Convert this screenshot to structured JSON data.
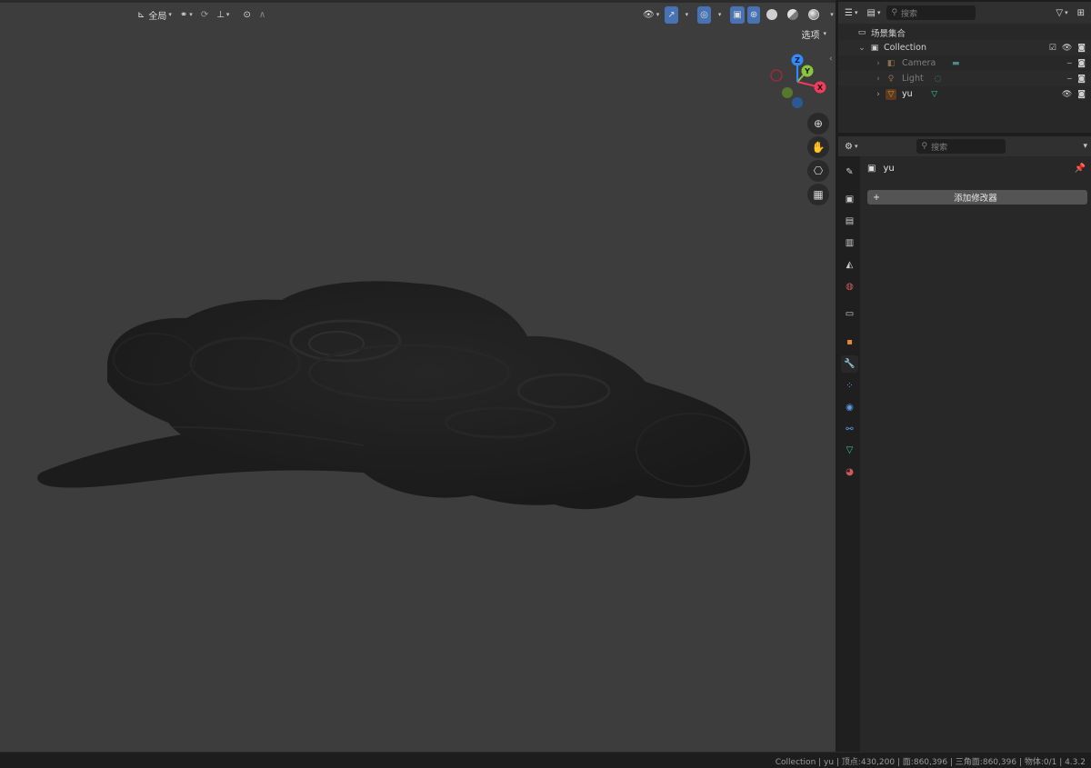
{
  "viewport_header": {
    "transform_orientation": "全局",
    "options_label": "选项"
  },
  "gizmo": {
    "x_label": "X",
    "y_label": "Y",
    "z_label": "Z",
    "colors": {
      "x": "#f53a5a",
      "y": "#8bc53f",
      "z": "#2f8bff",
      "neg_x": "#9a2b3d",
      "neg_y": "#55782b",
      "neg_z": "#2a5a96"
    }
  },
  "outliner": {
    "search_placeholder": "搜索",
    "scene_collection": "场景集合",
    "collection": "Collection",
    "items": [
      {
        "name": "Camera",
        "icon": "camera-icon",
        "data_icon": "camera-data-icon"
      },
      {
        "name": "Light",
        "icon": "light-icon",
        "data_icon": "light-data-icon"
      },
      {
        "name": "yu",
        "icon": "mesh-object-icon",
        "data_icon": "mesh-data-icon"
      }
    ]
  },
  "properties": {
    "search_placeholder": "搜索",
    "object_name": "yu",
    "add_modifier_label": "添加修改器",
    "tabs": [
      "tool-icon",
      "render-icon",
      "output-icon",
      "view-layer-icon",
      "scene-icon",
      "world-icon",
      "collection-icon",
      "object-icon",
      "modifier-icon",
      "particles-icon",
      "physics-icon",
      "constraints-icon",
      "data-icon",
      "material-icon"
    ]
  },
  "status_bar": {
    "text": "Collection | yu | 顶点:430,200 | 面:860,396 | 三角面:860,396 | 物体:0/1 | 4.3.2"
  },
  "colors": {
    "viewport_bg": "#3d3d3d",
    "panel_bg": "#282828",
    "accent_blue": "#4772b3",
    "mesh_color": "#1e1e1e"
  }
}
